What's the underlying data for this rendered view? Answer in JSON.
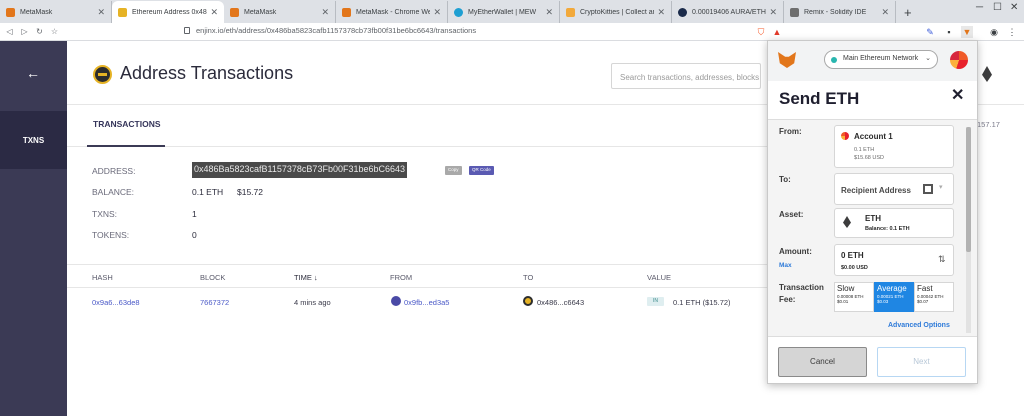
{
  "browser": {
    "tabs": [
      {
        "title": "MetaMask",
        "color": "#e2761b"
      },
      {
        "title": "Ethereum Address 0x486b",
        "color": "#e6b325"
      },
      {
        "title": "MetaMask",
        "color": "#e2761b"
      },
      {
        "title": "MetaMask - Chrome Web",
        "color": "#e2761b"
      },
      {
        "title": "MyEtherWallet | MEW",
        "color": "#1e9fd2"
      },
      {
        "title": "CryptoKitties | Collect and",
        "color": "#f2a93b"
      },
      {
        "title": "0.00019406 AURA/ETH -",
        "color": "#1a2a4a"
      },
      {
        "title": "Remix - Solidity IDE",
        "color": "#6e6e6e"
      }
    ],
    "new_tab": "+",
    "url": "enjinx.io/eth/address/0x486ba5823cafb1157378cb73fb00f31be6bc6643/transactions"
  },
  "sidebar": {
    "back_icon": "←",
    "txns_label": "TXNS"
  },
  "header": {
    "title": "Address Transactions",
    "search_placeholder": "Search transactions, addresses, blocks"
  },
  "tabs": {
    "transactions": "TRANSACTIONS"
  },
  "address_info": {
    "address_label": "ADDRESS:",
    "address_value": "0x486Ba5823cafB1157378cB73Fb00F31be6bC6643",
    "copy_label": "Copy",
    "qr_label": "QR Code",
    "balance_label": "BALANCE:",
    "balance_eth": "0.1 ETH",
    "balance_usd": "$15.72",
    "txns_label": "TXNS:",
    "txns_value": "1",
    "tokens_label": "TOKENS:",
    "tokens_value": "0"
  },
  "table": {
    "headers": [
      "HASH",
      "BLOCK",
      "TIME ↓",
      "FROM",
      "TO",
      "VALUE"
    ],
    "row": {
      "hash": "0x9a6...63de8",
      "block": "7667372",
      "time": "4 mins ago",
      "from": "0x9fb...ed3a5",
      "to": "0x486...c6643",
      "direction": "IN",
      "value": "0.1 ETH ($15.72)"
    },
    "right_amount": "157.17"
  },
  "metamask": {
    "network": "Main Ethereum Network",
    "title": "Send ETH",
    "close": "✕",
    "from_label": "From:",
    "account_name": "Account 1",
    "account_eth": "0.1 ETH",
    "account_usd": "$15.68 USD",
    "to_label": "To:",
    "recipient_placeholder": "Recipient Address",
    "asset_label": "Asset:",
    "asset_name": "ETH",
    "asset_balance": "Balance: 0.1 ETH",
    "amount_label": "Amount:",
    "max_label": "Max",
    "amount_value": "0  ETH",
    "amount_usd": "$0.00 USD",
    "fee_label_1": "Transaction",
    "fee_label_2": "Fee:",
    "fees": [
      {
        "name": "Slow",
        "eth": "0.00008 ETH",
        "usd": "$0.01"
      },
      {
        "name": "Average",
        "eth": "0.00021 ETH",
        "usd": "$0.03"
      },
      {
        "name": "Fast",
        "eth": "0.00042 ETH",
        "usd": "$0.07"
      }
    ],
    "advanced": "Advanced Options",
    "cancel": "Cancel",
    "next": "Next"
  }
}
